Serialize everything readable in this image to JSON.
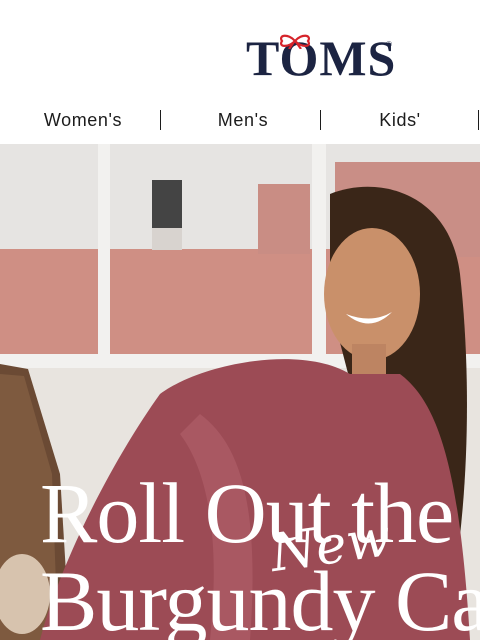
{
  "brand": {
    "name": "TOMS",
    "bow_icon": "red-bow-icon",
    "accent": "#d6242b",
    "color": "#1c2442"
  },
  "nav": {
    "items": [
      {
        "label": "Women's"
      },
      {
        "label": "Men's"
      },
      {
        "label": "Kids'"
      }
    ]
  },
  "hero": {
    "tagline": "New",
    "headline_line1": "Roll Out the",
    "headline_line2": "Burgundy Car"
  }
}
